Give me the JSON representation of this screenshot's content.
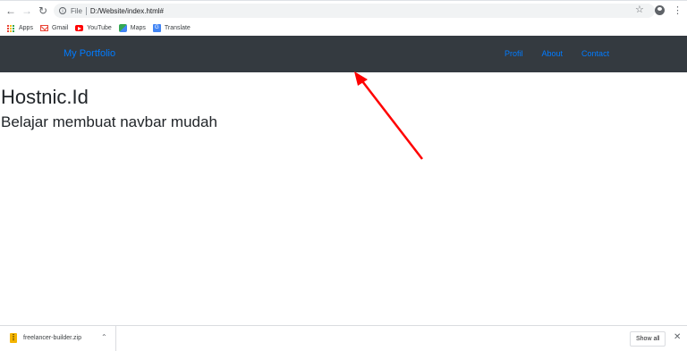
{
  "toolbar": {
    "back_icon": "arrow-left-icon",
    "forward_icon": "arrow-right-icon",
    "reload_icon": "reload-icon",
    "info_icon": "info-icon",
    "scheme_label": "File",
    "url": "D:/Website/index.html#",
    "star_icon": "star-icon",
    "profile_icon": "profile-icon",
    "menu_icon": "menu-dots-icon"
  },
  "bookmarks": {
    "items": [
      {
        "label": "Apps",
        "icon": "apps-grid-icon"
      },
      {
        "label": "Gmail",
        "icon": "gmail-icon"
      },
      {
        "label": "YouTube",
        "icon": "youtube-icon"
      },
      {
        "label": "Maps",
        "icon": "maps-icon"
      },
      {
        "label": "Translate",
        "icon": "translate-icon"
      }
    ]
  },
  "page": {
    "navbar": {
      "brand": "My Portfolio",
      "links": [
        "Profil",
        "About",
        "Contact"
      ],
      "background": "#343a40",
      "link_color": "#007bff"
    },
    "heading": "Hostnic.Id",
    "subheading": "Belajar membuat navbar mudah",
    "annotation_arrow_color": "#ff0000"
  },
  "downloads": {
    "file_name": "freelancer-builder.zip",
    "file_icon": "zip-file-icon",
    "caret_icon": "chevron-up-icon",
    "show_all_label": "Show all",
    "close_icon": "close-icon"
  }
}
